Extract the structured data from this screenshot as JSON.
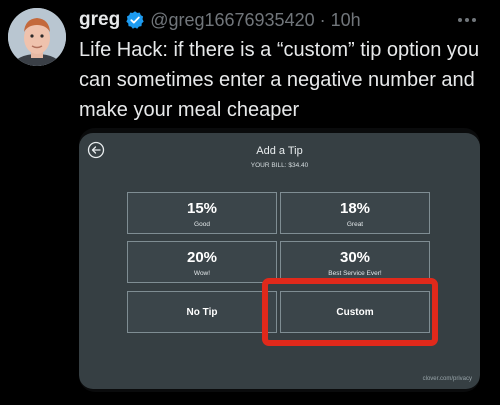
{
  "tweet": {
    "author_name": "greg",
    "handle": "@greg16676935420",
    "separator": "·",
    "time": "10h",
    "text": "Life Hack: if there is a “custom” tip option you can sometimes enter a negative number and make your meal cheaper"
  },
  "screenshot": {
    "title": "Add a Tip",
    "bill_label": "YOUR BILL: $34.40",
    "tip_options": [
      {
        "percent": "15%",
        "label": "Good"
      },
      {
        "percent": "18%",
        "label": "Great"
      },
      {
        "percent": "20%",
        "label": "Wow!"
      },
      {
        "percent": "30%",
        "label": "Best Service Ever!"
      }
    ],
    "no_tip_label": "No Tip",
    "custom_label": "Custom",
    "footer_link": "clover.com/privacy"
  },
  "colors": {
    "background": "#000000",
    "verified": "#1d9bf0",
    "highlight": "#e0291b",
    "terminal_bg": "#363f43"
  },
  "icons": {
    "verified": "verified-badge-icon",
    "more": "more-horizontal-icon",
    "back": "back-arrow-icon"
  }
}
